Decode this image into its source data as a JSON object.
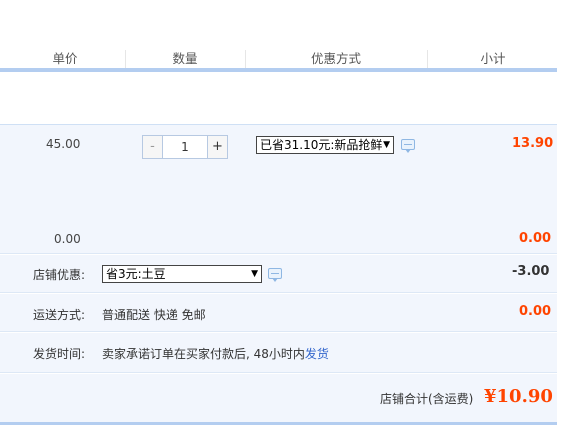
{
  "columns": {
    "unit_price": "单价",
    "quantity": "数量",
    "discount": "优惠方式",
    "subtotal": "小计"
  },
  "item": {
    "price": "45.00",
    "quantity": "1",
    "minus": "-",
    "plus": "+",
    "promo_selected": "已省31.10元:新品抢鲜",
    "subtotal": "13.90"
  },
  "item_extra": {
    "price": "0.00",
    "subtotal": "0.00"
  },
  "shop_discount": {
    "label": "店铺优惠:",
    "selected": "省3元:土豆",
    "amount": "-3.00"
  },
  "shipping": {
    "label": "运送方式:",
    "value": "普通配送 快递 免邮",
    "amount": "0.00"
  },
  "delivery": {
    "label": "发货时间:",
    "value_prefix": "卖家承诺订单在买家付款后, 48小时内",
    "value_link": "发货"
  },
  "total": {
    "label": "店铺合计(含运费)",
    "value": "¥10.90"
  },
  "colors": {
    "accent_orange": "#ff4400",
    "header_rule": "#b3cdf0",
    "row_bg": "#f2f6fd"
  }
}
